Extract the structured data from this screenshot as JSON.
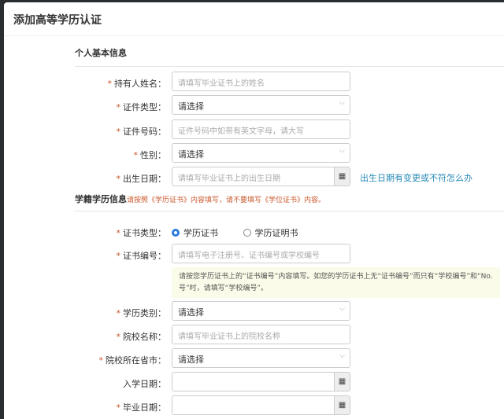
{
  "title": "添加高等学历认证",
  "section1": "个人基本信息",
  "fields1": [
    {
      "label": "持有人姓名：",
      "placeholder": "请填写毕业证书上的姓名"
    },
    {
      "label": "证件类型：",
      "value": "请选择"
    },
    {
      "label": "证件号码：",
      "placeholder": "证件号码中如带有英文字母，请大写"
    },
    {
      "label": "性别：",
      "value": "请选择"
    },
    {
      "label": "出生日期：",
      "placeholder": "请填写毕业证书上的出生日期"
    }
  ],
  "birth_link": "出生日期有变更或不符怎么办",
  "section2": "学籍学历信息",
  "section2_note": "请按照《学历证书》内容填写，请不要填写《学位证书》内容。",
  "cert_type": {
    "label": "证书类型：",
    "options": [
      "学历证书",
      "学历证明书"
    ],
    "selected": "学历证书"
  },
  "cert_no": {
    "label": "证书编号：",
    "placeholder": "请填写电子注册号、证书编号或学校编号"
  },
  "tip": "请按您学历证书上的“证书编号”内容填写。如您的学历证书上无“证书编号”而只有“学校编号”和“No.号”时，请填写“学校编号”。",
  "fields2": [
    {
      "label": "学历类别：",
      "value": "请选择"
    },
    {
      "label": "院校名称：",
      "placeholder": "请填写毕业证书上的院校名称"
    },
    {
      "label": "院校所在省市：",
      "value": "请选择"
    },
    {
      "label": "入学日期：",
      "value": ""
    },
    {
      "label": "毕业日期：",
      "value": ""
    }
  ],
  "star": "*",
  "icons": {
    "calendar": "▦",
    "chevron": "⌵"
  }
}
